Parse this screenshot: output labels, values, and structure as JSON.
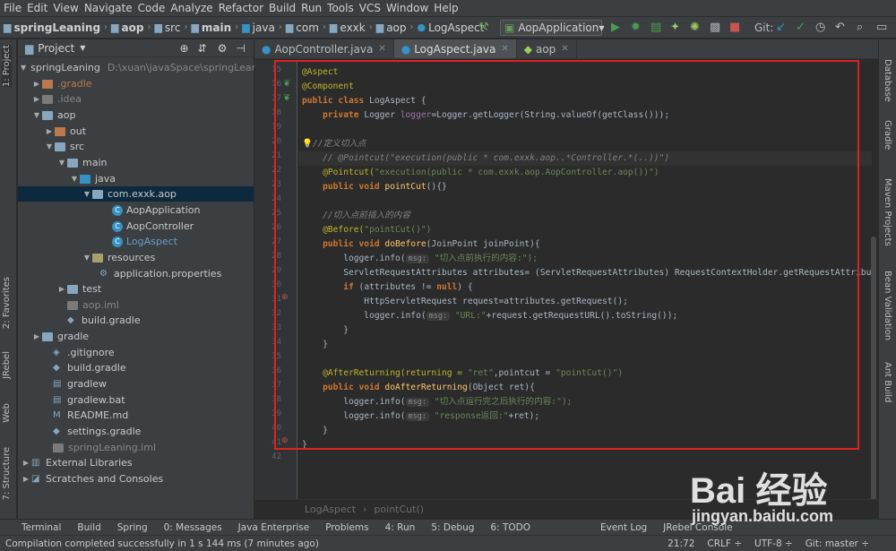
{
  "menu": [
    "File",
    "Edit",
    "View",
    "Navigate",
    "Code",
    "Analyze",
    "Refactor",
    "Build",
    "Run",
    "Tools",
    "VCS",
    "Window",
    "Help"
  ],
  "breadcrumbs": [
    "springLeaning",
    "aop",
    "src",
    "main",
    "java",
    "com",
    "exxk",
    "aop",
    "LogAspect"
  ],
  "run_config": "AopApplication",
  "git_label": "Git:",
  "left_tabs": [
    "1: Project",
    "2: Favorites",
    "JRebel",
    "Web",
    "7: Structure"
  ],
  "right_tabs": [
    "Database",
    "Gradle",
    "Maven Projects",
    "Bean Validation",
    "Ant Build"
  ],
  "project_panel": {
    "title": "Project"
  },
  "tree": [
    {
      "label": "springLeaning",
      "path": "D:\\xuan\\javaSpace\\springLeani"
    },
    {
      "label": ".gradle"
    },
    {
      "label": ".idea"
    },
    {
      "label": "aop"
    },
    {
      "label": "out"
    },
    {
      "label": "src"
    },
    {
      "label": "main"
    },
    {
      "label": "java"
    },
    {
      "label": "com.exxk.aop"
    },
    {
      "label": "AopApplication"
    },
    {
      "label": "AopController"
    },
    {
      "label": "LogAspect"
    },
    {
      "label": "resources"
    },
    {
      "label": "application.properties"
    },
    {
      "label": "test"
    },
    {
      "label": "aop.iml"
    },
    {
      "label": "build.gradle"
    },
    {
      "label": "gradle"
    },
    {
      "label": ".gitignore"
    },
    {
      "label": "build.gradle"
    },
    {
      "label": "gradlew"
    },
    {
      "label": "gradlew.bat"
    },
    {
      "label": "README.md"
    },
    {
      "label": "settings.gradle"
    },
    {
      "label": "springLeaning.iml"
    },
    {
      "label": "External Libraries"
    },
    {
      "label": "Scratches and Consoles"
    }
  ],
  "tabs": [
    {
      "label": "AopController.java"
    },
    {
      "label": "LogAspect.java"
    },
    {
      "label": "aop"
    }
  ],
  "line_numbers": [
    "15",
    "16",
    "17",
    "18",
    "19",
    "20",
    "21",
    "22",
    "23",
    "24",
    "25",
    "26",
    "27",
    "28",
    "29",
    "30",
    "31",
    "32",
    "33",
    "34",
    "35",
    "36",
    "37",
    "38",
    "39",
    "40",
    "41",
    "42"
  ],
  "code": {
    "l15": "@Aspect",
    "l16": "@Component",
    "l17a": "public class ",
    "l17b": "LogAspect {",
    "l18a": "    private ",
    "l18b": "Logger ",
    "l18c": "logger",
    "l18d": "=Logger.getLogger(String.valueOf(getClass()));",
    "l20": "//定义切入点",
    "l21": "    // @Pointcut(\"execution(public * com.exxk.aop..*Controller.*(..))\")",
    "l22a": "    @Pointcut(",
    "l22b": "\"execution(public * com.exxk.aop.AopController.aop())\")",
    "l23a": "    public void ",
    "l23b": "pointCut",
    "l23c": "(){}",
    "l25": "    //切入点前插入的内容",
    "l26a": "    @Before(",
    "l26b": "\"pointCut()\")",
    "l27a": "    public void ",
    "l27b": "doBefore",
    "l27c": "(JoinPoint joinPoint){",
    "l28a": "        logger.info(",
    "l28h": "msg:",
    "l28b": " \"切入点前执行的内容:\");",
    "l29": "        ServletRequestAttributes attributes= (ServletRequestAttributes) RequestContextHolder.getRequestAttributes();",
    "l30a": "        if ",
    "l30b": "(attributes != ",
    "l30c": "null",
    "l30d": ") {",
    "l31": "            HttpServletRequest request=attributes.getRequest();",
    "l32a": "            logger.info(",
    "l32h": "msg:",
    "l32b": " \"URL:\"",
    "l32c": "+request.getRequestURL().toString());",
    "l33": "        }",
    "l34": "    }",
    "l36a": "    @AfterReturning(returning = ",
    "l36b": "\"ret\"",
    ",l36c": "",
    "l36d": ",pointcut = ",
    "l36e": "\"pointCut()\")",
    "l37a": "    public void ",
    "l37b": "doAfterReturning",
    "l37c": "(Object ret){",
    "l38a": "        logger.info(",
    "l38h": "msg:",
    "l38b": " \"切入点运行完之后执行的内容:\");",
    "l39a": "        logger.info(",
    "l39h": "msg:",
    "l39b": " \"response返回:\"",
    "l39c": "+ret);",
    "l40": "    }",
    "l41": "}"
  },
  "editor_breadcrumb": {
    "class": "LogAspect",
    "method": "pointCut()",
    "sep": "›"
  },
  "bottom_tools": [
    "Terminal",
    "Build",
    "Spring",
    "0: Messages",
    "Java Enterprise",
    "Problems",
    "4: Run",
    "5: Debug",
    "6: TODO",
    "Event Log",
    "JRebel Console"
  ],
  "status": {
    "message": "Compilation completed successfully in 1 s 144 ms (7 minutes ago)",
    "position": "21:72",
    "line_sep": "CRLF ÷",
    "encoding": "UTF-8 ÷",
    "git": "Git: master ÷"
  },
  "watermark": {
    "brand": "Bai 经验",
    "site": "jingyan.baidu.com"
  }
}
